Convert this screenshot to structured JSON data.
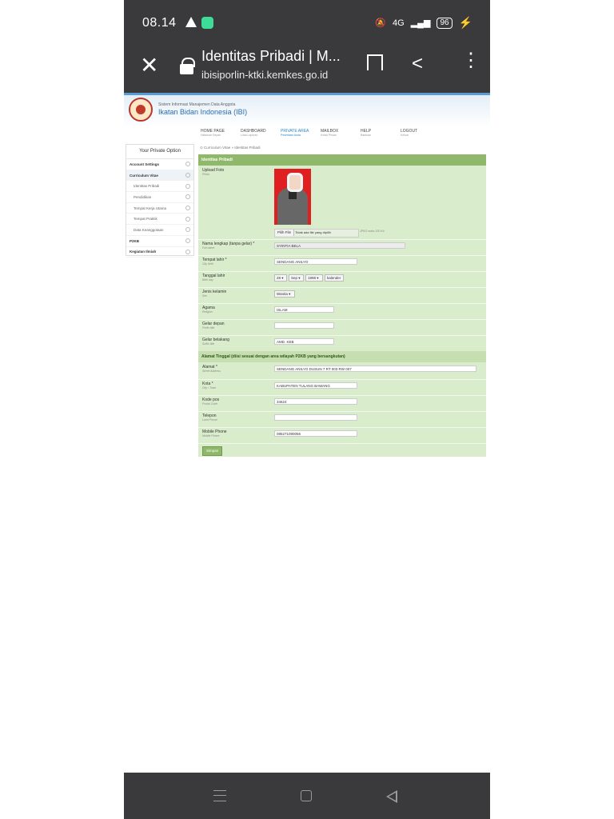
{
  "status_bar": {
    "time": "08.14",
    "network": "4G",
    "battery": "96",
    "icons": [
      "warning-icon",
      "app-notification-icon",
      "mute-icon",
      "signal-icon",
      "wifi-icon",
      "battery-icon",
      "charging-icon"
    ]
  },
  "browser": {
    "page_title": "Identitas Pribadi | M...",
    "url": "ibisiporlin-ktki.kemkes.go.id",
    "icons": [
      "close-icon",
      "lock-icon",
      "bookmark-icon",
      "share-icon",
      "more-icon"
    ]
  },
  "site": {
    "small_title": "Sistem Informasi Manajemen Data Anggota",
    "big_title": "Ikatan Bidan Indonesia (IBI)",
    "nav": [
      {
        "label": "HOME PAGE",
        "sub": "Halaman Depan"
      },
      {
        "label": "DASHBOARD",
        "sub": "Lihat Laporan"
      },
      {
        "label": "PRIVATE AREA",
        "sub": "Pesertaan Anda"
      },
      {
        "label": "MAILBOX",
        "sub": "Kotak Pesan"
      },
      {
        "label": "HELP",
        "sub": "Bantuan"
      },
      {
        "label": "LOGOUT",
        "sub": "Keluar"
      }
    ],
    "active_nav": "PRIVATE AREA"
  },
  "sidebar": {
    "heading": "Your Private Option",
    "items": [
      {
        "label": "Account Settings"
      },
      {
        "label": "Curriculum Vitae"
      },
      {
        "label": "Identitas Pribadi"
      },
      {
        "label": "Pendidikan"
      },
      {
        "label": "Tempat Kerja Utama"
      },
      {
        "label": "Tempat Praktik"
      },
      {
        "label": "Data Keanggotaan"
      },
      {
        "label": "P2KB"
      },
      {
        "label": "Kegiatan Ilmiah"
      }
    ]
  },
  "breadcrumb": "Curriculum Vitae » Identitas Pribadi",
  "form": {
    "title": "Identitas Pribadi",
    "photo": {
      "label": "Upload Foto",
      "sub": "Photo",
      "file_button": "Pilih File",
      "file_status": "Tidak ada file yang dipilih",
      "hint": "JPEG maks 150 Kb"
    },
    "fields": [
      {
        "label": "Nama lengkap (tanpa gelar) *",
        "sub": "Full name",
        "value": "SYINTIA BELA"
      },
      {
        "label": "Tempat lahir *",
        "sub": "City birth",
        "value": "SENDANG ANILYO"
      },
      {
        "label": "Tanggal lahir",
        "sub": "Birth day",
        "day": "28",
        "month": "Sep",
        "year": "1998",
        "calendar": "kalender"
      },
      {
        "label": "Jenis kelamin",
        "sub": "Sex",
        "value": "Wanita"
      },
      {
        "label": "Agama",
        "sub": "Religion",
        "value": "ISLAM"
      },
      {
        "label": "Gelar depan",
        "sub": "Prefix title",
        "value": ""
      },
      {
        "label": "Gelar belakang",
        "sub": "Suffix title",
        "value": "AMD. KEB"
      }
    ],
    "address_section": "Alamat Tinggal (diisi sesuai dengan area wilayah P2KB yang bersangkutan)",
    "address_fields": [
      {
        "label": "Alamat *",
        "sub": "Street Address",
        "value": "SENDANG ANILYO DUSUN 7 RT 003 RW 007"
      },
      {
        "label": "Kota *",
        "sub": "City / Town",
        "value": "KABUPATEN TULANG BAWANG"
      },
      {
        "label": "Kode pos",
        "sub": "Postal Code",
        "value": "34624"
      },
      {
        "label": "Telepon",
        "sub": "Land Phone",
        "value": ""
      },
      {
        "label": "Mobile Phone",
        "sub": "Mobile Phone",
        "value": "085271090056"
      }
    ],
    "save_button": "Simpan"
  }
}
